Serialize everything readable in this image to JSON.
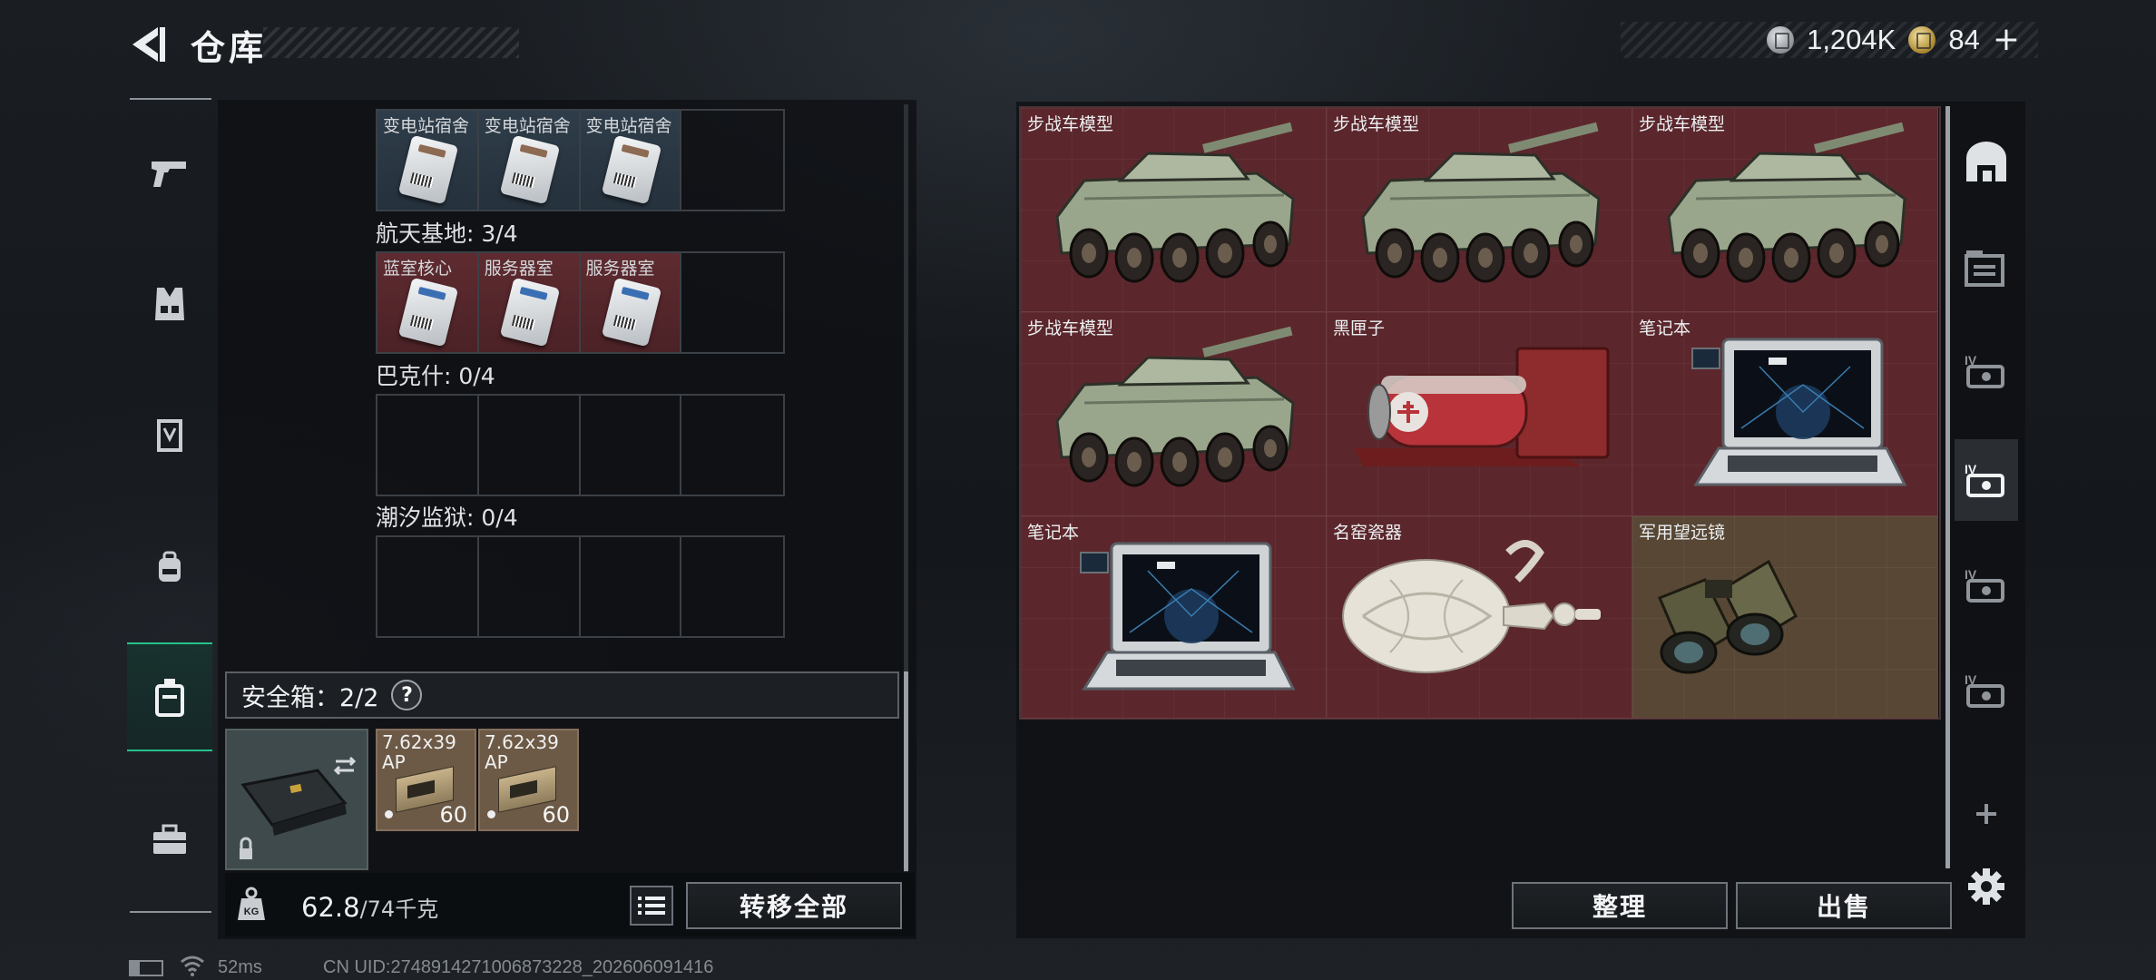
{
  "header": {
    "title": "仓库",
    "currencies": [
      {
        "icon": "silver-coin-icon",
        "value": "1,204K"
      },
      {
        "icon": "gold-coin-icon",
        "value": "84"
      }
    ],
    "plus": "+"
  },
  "left_nav": [
    {
      "icon": "pistol-icon"
    },
    {
      "icon": "vest-icon"
    },
    {
      "icon": "armor-icon"
    },
    {
      "icon": "backpack-icon"
    },
    {
      "icon": "safe-box-icon",
      "active": true
    },
    {
      "icon": "toolbox-icon"
    }
  ],
  "keycard_groups": {
    "top": {
      "slots": [
        {
          "label": "变电站宿舍",
          "color": "blue"
        },
        {
          "label": "变电站宿舍",
          "color": "blue"
        },
        {
          "label": "变电站宿舍",
          "color": "blue"
        },
        {
          "label": "",
          "color": "empty"
        }
      ]
    },
    "hangtian": {
      "title": "航天基地: 3/4",
      "slots": [
        {
          "label": "蓝室核心",
          "color": "red"
        },
        {
          "label": "服务器室",
          "color": "red"
        },
        {
          "label": "服务器室",
          "color": "red"
        },
        {
          "label": "",
          "color": "empty"
        }
      ]
    },
    "bakeshi": {
      "title": "巴克什: 0/4"
    },
    "chaoxi": {
      "title": "潮汐监狱: 0/4"
    }
  },
  "safe_box": {
    "title": "安全箱：2/2",
    "help": "?",
    "ammo": [
      {
        "label_line1": "7.62x39",
        "label_line2": "AP",
        "count": "60"
      },
      {
        "label_line1": "7.62x39",
        "label_line2": "AP",
        "count": "60"
      }
    ]
  },
  "bottom": {
    "weight_current": "62.8",
    "weight_max": "/74千克",
    "weight_icon_text": "KG",
    "transfer_all": "转移全部"
  },
  "stash_items": [
    {
      "label": "步战车模型",
      "type": "ifv"
    },
    {
      "label": "步战车模型",
      "type": "ifv"
    },
    {
      "label": "步战车模型",
      "type": "ifv"
    },
    {
      "label": "步战车模型",
      "type": "ifv"
    },
    {
      "label": "黑匣子",
      "type": "blackbox"
    },
    {
      "label": "笔记本",
      "type": "laptop"
    },
    {
      "label": "笔记本",
      "type": "laptop"
    },
    {
      "label": "名窑瓷器",
      "type": "vase"
    },
    {
      "label": "军用望远镜",
      "type": "binoculars"
    }
  ],
  "actions": {
    "sort": "整理",
    "sell": "出售"
  },
  "right_nav": [
    {
      "icon": "stash-home-icon"
    },
    {
      "icon": "folder-container-icon"
    },
    {
      "icon": "case-iv-icon"
    },
    {
      "icon": "case-iv-icon",
      "active": true
    },
    {
      "icon": "case-iv-icon"
    },
    {
      "icon": "case-iv-icon"
    }
  ],
  "status_bar": {
    "ping": "52ms",
    "uid": "CN UID:2748914271006873228_202606091416"
  }
}
